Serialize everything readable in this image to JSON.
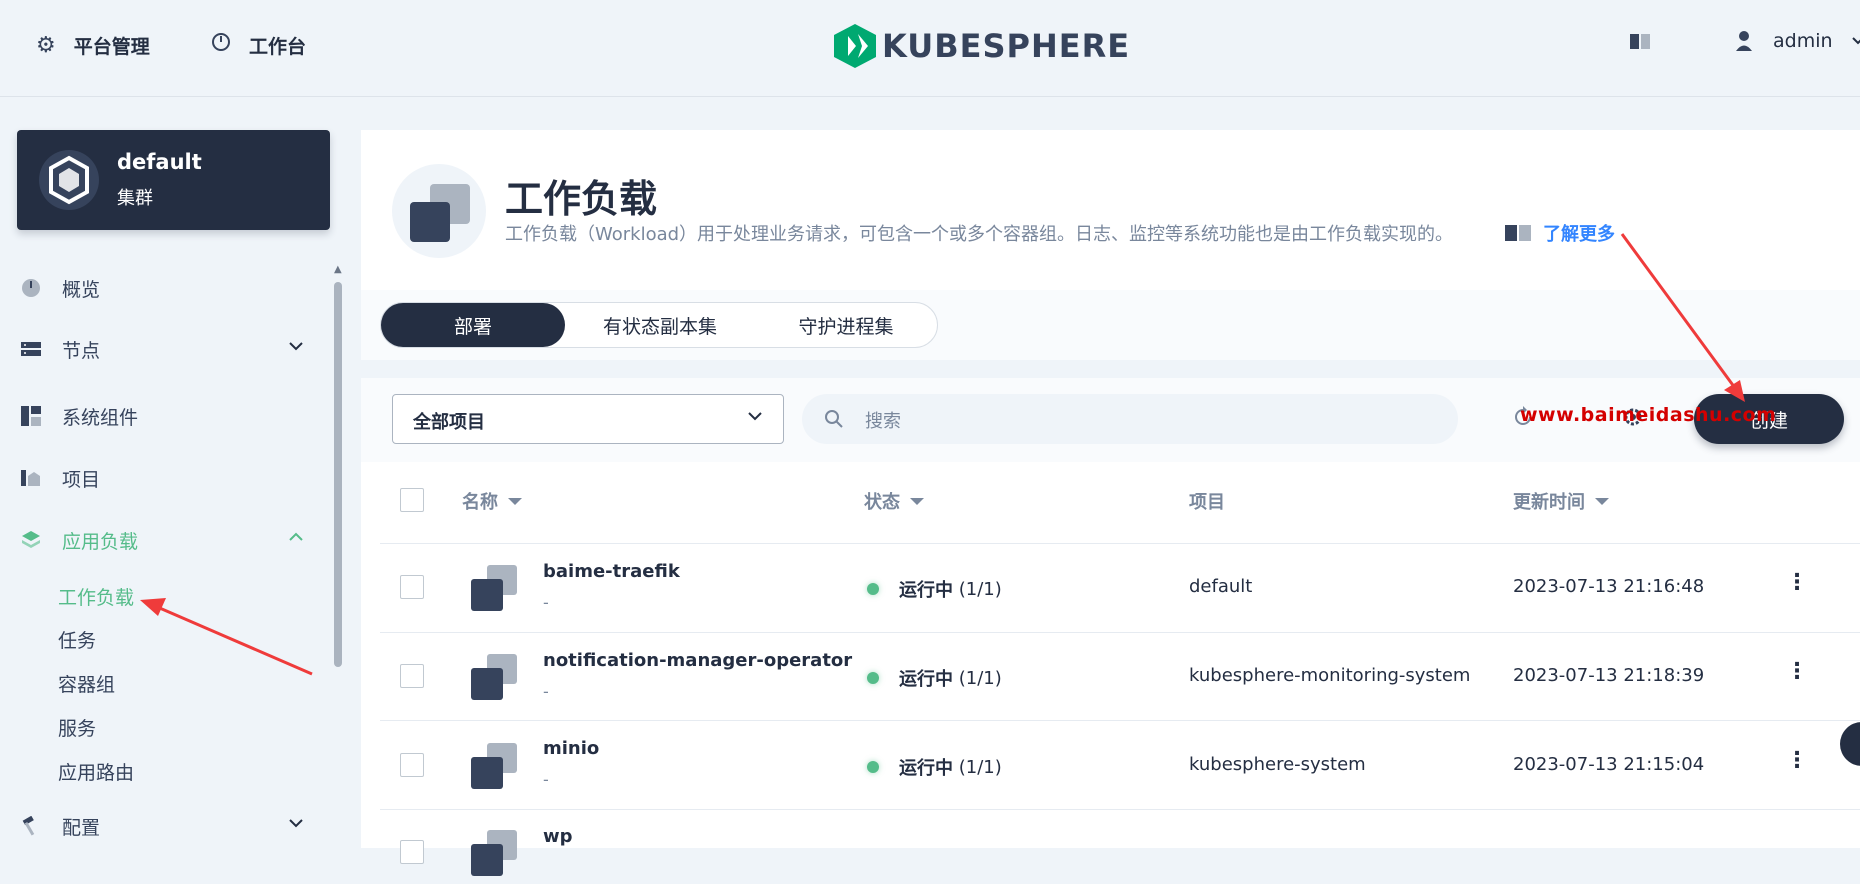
{
  "topbar": {
    "platform_label": "平台管理",
    "workbench_label": "工作台",
    "logo_text": "KUBESPHERE",
    "username": "admin"
  },
  "sidebar": {
    "cluster_name": "default",
    "cluster_sub": "集群",
    "items": [
      {
        "label": "概览",
        "icon": "dashboard-icon"
      },
      {
        "label": "节点",
        "icon": "server-icon",
        "expandable": true
      },
      {
        "label": "系统组件",
        "icon": "components-icon"
      },
      {
        "label": "项目",
        "icon": "project-icon"
      },
      {
        "label": "应用负载",
        "icon": "layers-icon",
        "expanded": true,
        "active": true
      },
      {
        "label": "配置",
        "icon": "hammer-icon",
        "expandable": true
      }
    ],
    "subitems": [
      "工作负载",
      "任务",
      "容器组",
      "服务",
      "应用路由"
    ]
  },
  "header": {
    "title": "工作负载",
    "description": "工作负载（Workload）用于处理业务请求，可包含一个或多个容器组。日志、监控等系统功能也是由工作负载实现的。",
    "learn_more": "了解更多"
  },
  "tabs": [
    "部署",
    "有状态副本集",
    "守护进程集"
  ],
  "toolbar": {
    "project_select": "全部项目",
    "search_placeholder": "搜索",
    "create_label": "创建"
  },
  "table": {
    "columns": [
      "名称",
      "状态",
      "项目",
      "更新时间"
    ],
    "rows": [
      {
        "name": "baime-traefik",
        "sub": "-",
        "status": "运行中",
        "replicas": "(1/1)",
        "project": "default",
        "updated": "2023-07-13 21:16:48"
      },
      {
        "name": "notification-manager-operator",
        "sub": "-",
        "status": "运行中",
        "replicas": "(1/1)",
        "project": "kubesphere-monitoring-system",
        "updated": "2023-07-13 21:18:39"
      },
      {
        "name": "minio",
        "sub": "-",
        "status": "运行中",
        "replicas": "(1/1)",
        "project": "kubesphere-system",
        "updated": "2023-07-13 21:15:04"
      },
      {
        "name": "wp",
        "sub": "",
        "status": "",
        "replicas": "",
        "project": "",
        "updated": ""
      }
    ]
  },
  "watermark": "www.baimeidashu.com",
  "colors": {
    "accent_green": "#55bc8a",
    "dark": "#242e42",
    "arrow_red": "#ef3b3b"
  }
}
